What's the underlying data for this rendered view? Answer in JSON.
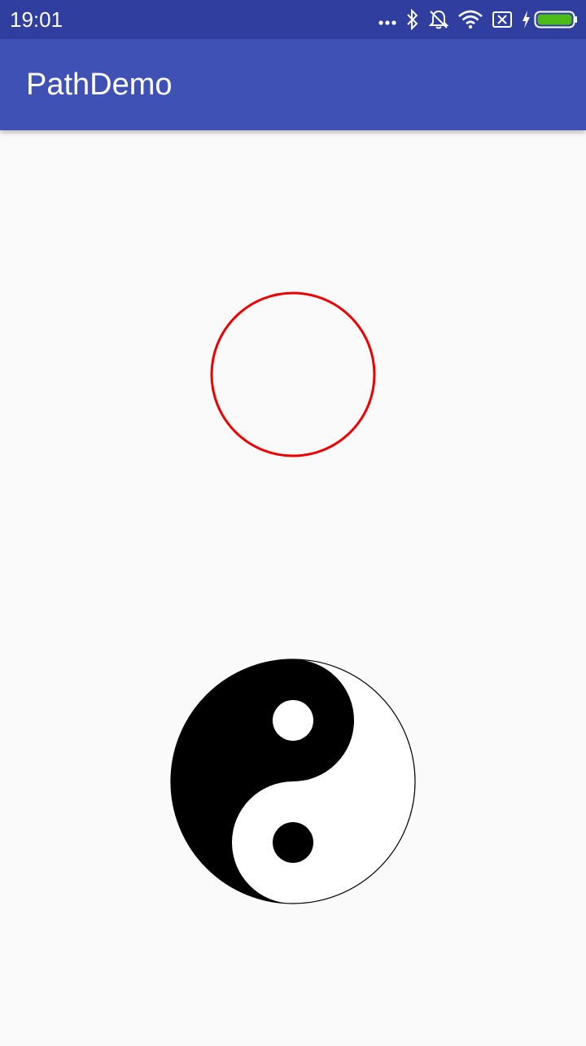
{
  "status_bar": {
    "time": "19:01",
    "icons": [
      "more-dots-icon",
      "bluetooth-icon",
      "alarm-off-icon",
      "wifi-icon",
      "sim-error-icon",
      "charging-bolt-icon",
      "battery-icon"
    ],
    "battery_color": "#4CBB17",
    "bar_color": "#303F9F"
  },
  "app_bar": {
    "title": "PathDemo",
    "color": "#3F51B5"
  },
  "canvas": {
    "background": "#FAFAFA",
    "circle_stroke_color": "#EE0000",
    "yin_yang_dark": "#000000",
    "yin_yang_light": "#FFFFFF"
  }
}
